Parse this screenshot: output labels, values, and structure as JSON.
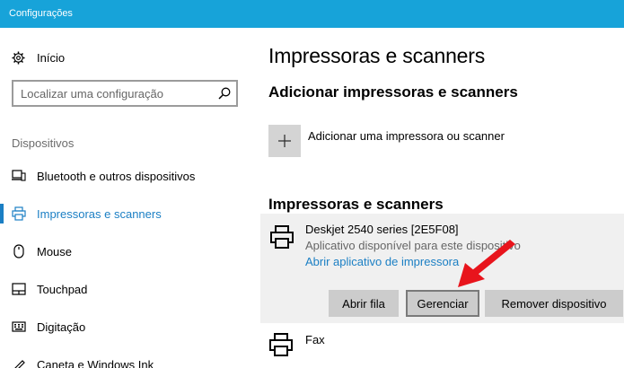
{
  "window": {
    "title": "Configurações"
  },
  "sidebar": {
    "home_label": "Início",
    "search": {
      "placeholder": "Localizar uma configuração"
    },
    "section_label": "Dispositivos",
    "items": [
      {
        "label": "Bluetooth e outros dispositivos",
        "icon": "bluetooth-devices-icon",
        "active": false
      },
      {
        "label": "Impressoras e scanners",
        "icon": "printer-icon",
        "active": true
      },
      {
        "label": "Mouse",
        "icon": "mouse-icon",
        "active": false
      },
      {
        "label": "Touchpad",
        "icon": "touchpad-icon",
        "active": false
      },
      {
        "label": "Digitação",
        "icon": "keyboard-icon",
        "active": false
      },
      {
        "label": "Caneta e Windows Ink",
        "icon": "pen-icon",
        "active": false
      }
    ]
  },
  "main": {
    "title": "Impressoras e scanners",
    "add_section": {
      "heading": "Adicionar impressoras e scanners",
      "add_label": "Adicionar uma impressora ou scanner"
    },
    "list_heading": "Impressoras e scanners",
    "printers": [
      {
        "name": "Deskjet 2540 series [2E5F08]",
        "status": "Aplicativo disponível para este dispositivo",
        "link": "Abrir aplicativo de impressora",
        "buttons": {
          "open_queue": "Abrir fila",
          "manage": "Gerenciar",
          "remove": "Remover dispositivo"
        }
      },
      {
        "name": "Fax"
      }
    ]
  },
  "colors": {
    "titlebar": "#17a3d9",
    "accent": "#1b7fc4",
    "annotation_arrow": "#e8141c"
  }
}
